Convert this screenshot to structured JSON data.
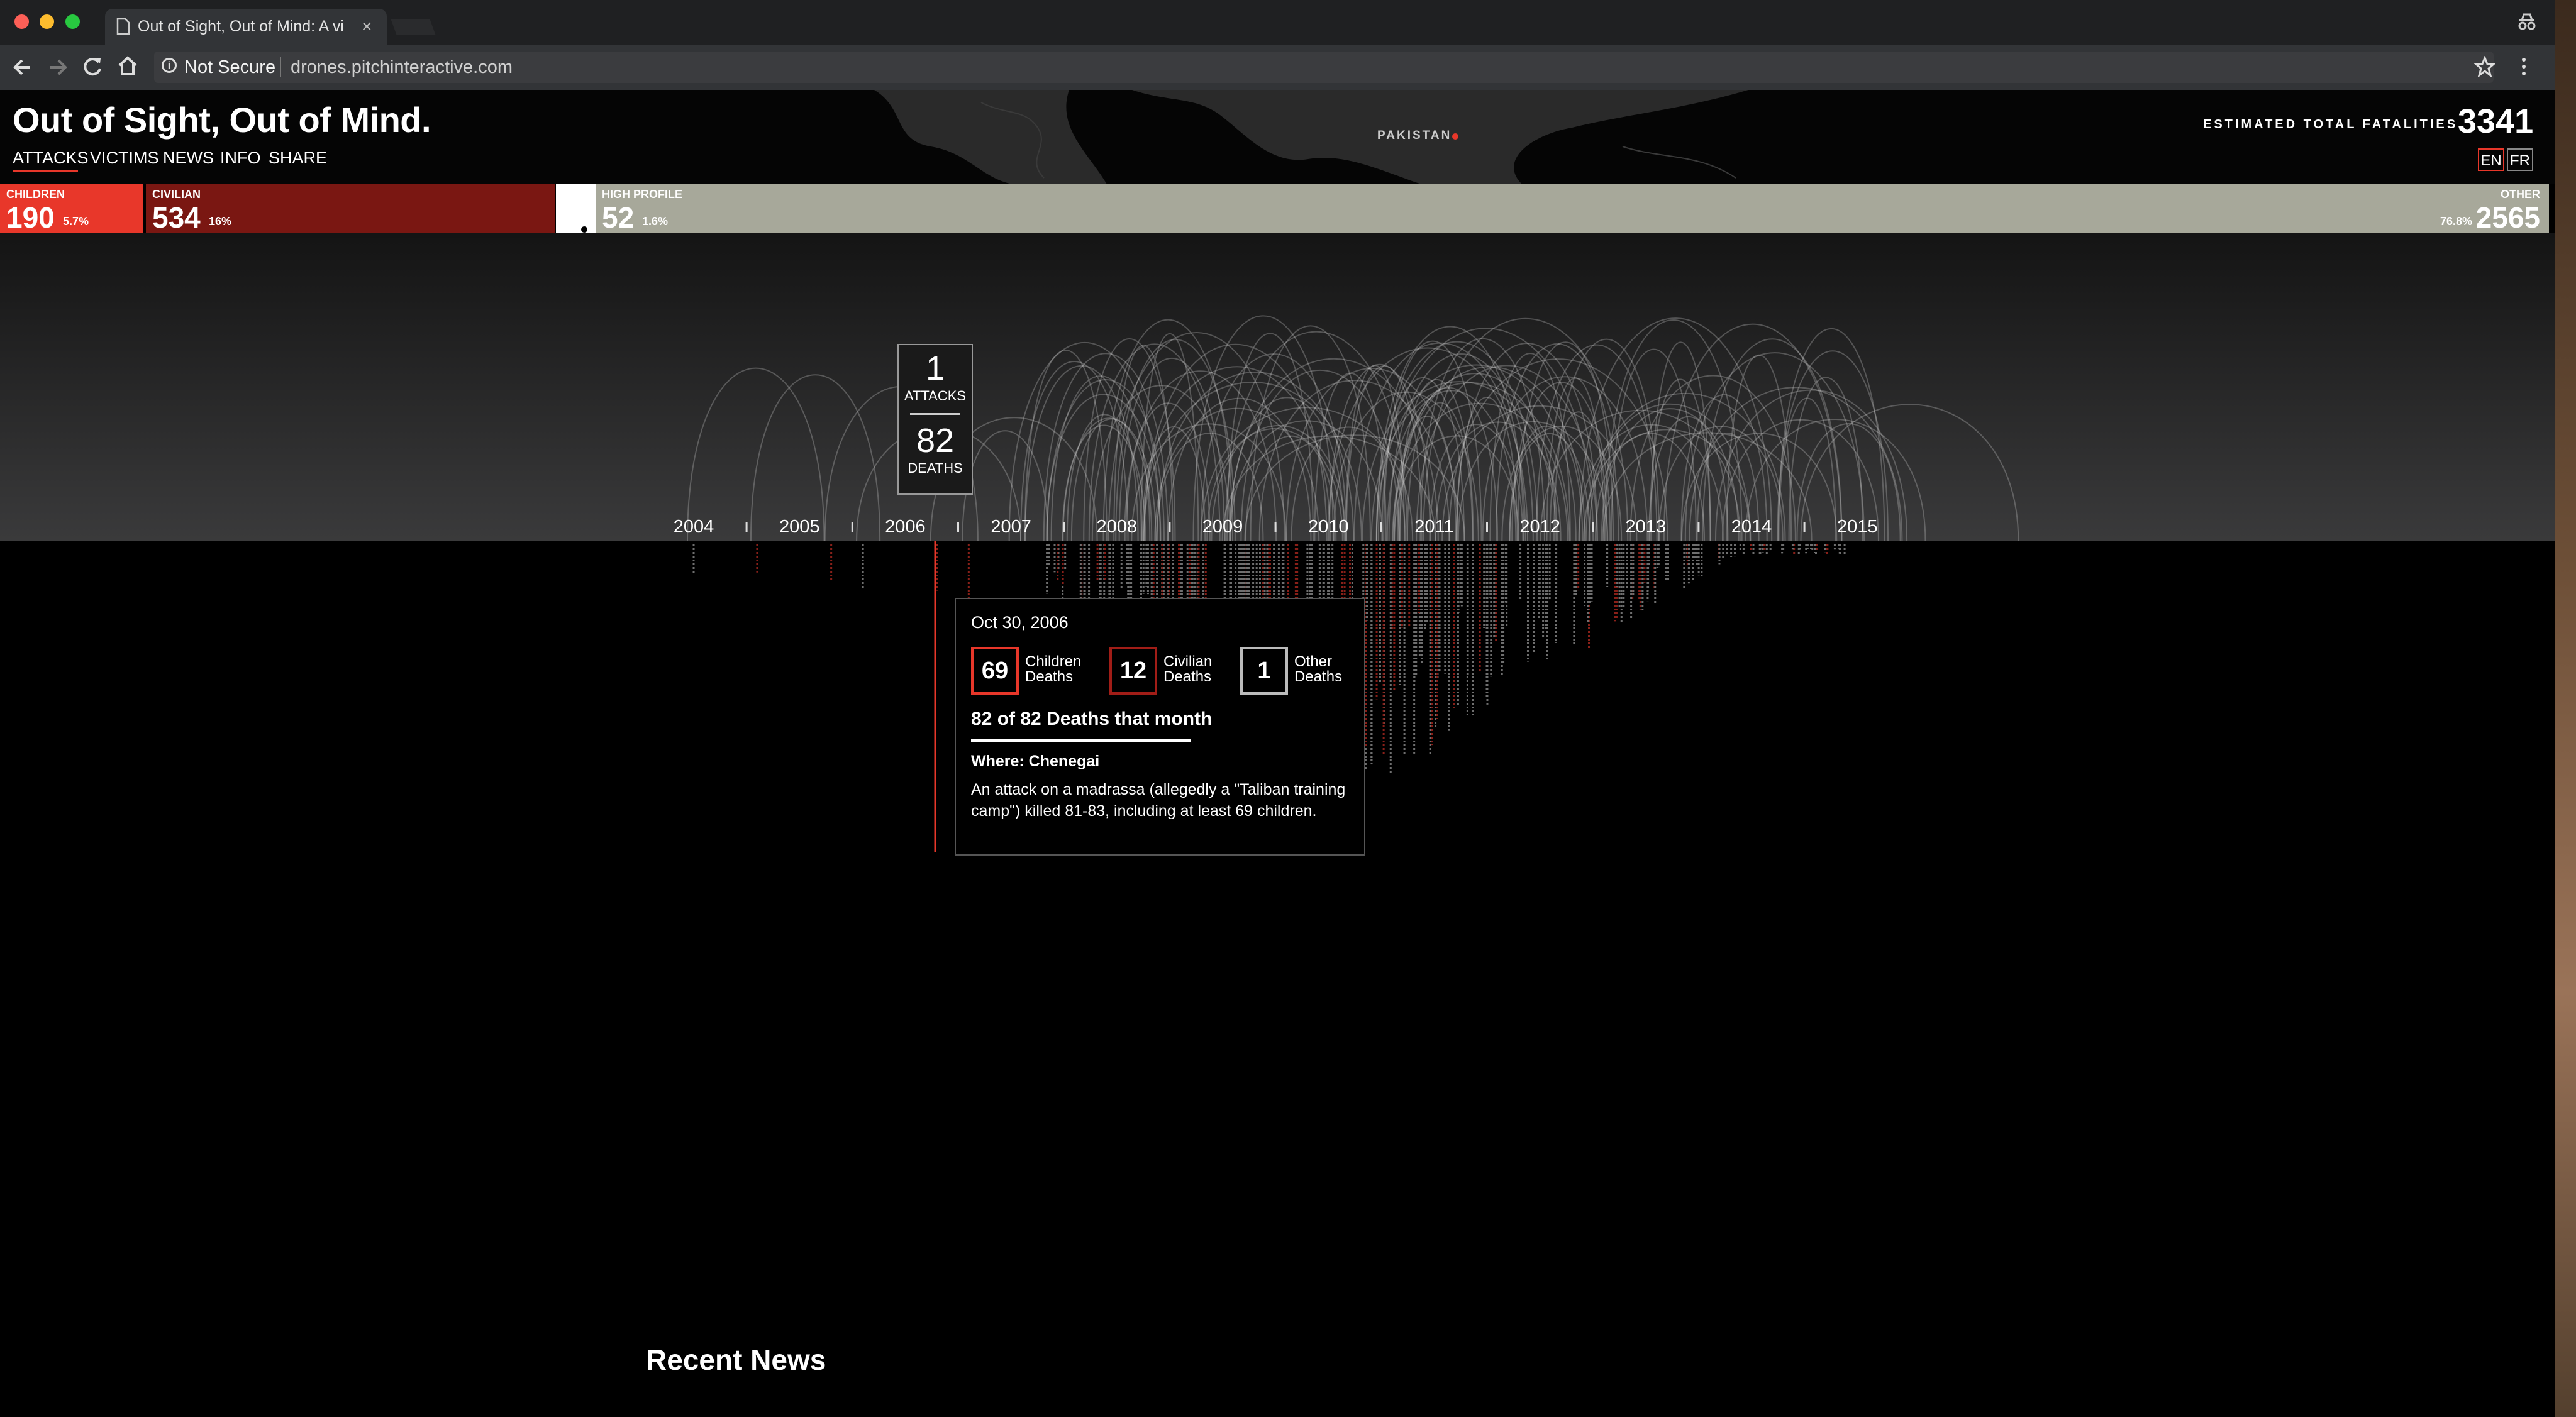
{
  "browser": {
    "tab_title": "Out of Sight, Out of Mind: A vi",
    "tab_close": "×",
    "not_secure": "Not Secure",
    "url": "drones.pitchinteractive.com",
    "info_glyph": "i"
  },
  "header": {
    "title": "Out of Sight, Out of Mind.",
    "nav": [
      "ATTACKS",
      "VICTIMS",
      "NEWS",
      "INFO",
      "SHARE"
    ],
    "active_nav": "ATTACKS",
    "map_label": "PAKISTAN",
    "fatalities_label": "ESTIMATED TOTAL FATALITIES",
    "fatalities_value": "3341",
    "languages": [
      "EN",
      "FR"
    ]
  },
  "categories": {
    "children": {
      "label": "CHILDREN",
      "count": "190",
      "pct": "5.7%",
      "color": "#e8372a"
    },
    "civilian": {
      "label": "CIVILIAN",
      "count": "534",
      "pct": "16%",
      "color": "#7a1712"
    },
    "high_profile": {
      "label": "HIGH PROFILE",
      "count": "52",
      "pct": "1.6%",
      "color": "#ffffff"
    },
    "other": {
      "label": "OTHER",
      "count": "2565",
      "pct": "76.8%",
      "color": "#a7a89a"
    }
  },
  "chart_data": {
    "type": "timeline",
    "years": [
      "2004",
      "2005",
      "2006",
      "2007",
      "2008",
      "2009",
      "2010",
      "2011",
      "2012",
      "2013",
      "2014",
      "2015"
    ],
    "selected_year_position": 2006.83
  },
  "hover_callout": {
    "attacks_value": "1",
    "attacks_label": "ATTACKS",
    "deaths_value": "82",
    "deaths_label": "DEATHS"
  },
  "tooltip": {
    "date": "Oct 30, 2006",
    "children_value": "69",
    "children_label_1": "Children",
    "children_label_2": "Deaths",
    "civilian_value": "12",
    "civilian_label_1": "Civilian",
    "civilian_label_2": "Deaths",
    "other_value": "1",
    "other_label_1": "Other",
    "other_label_2": "Deaths",
    "total_text": "82 of 82 Deaths that month",
    "where": "Where: Chenegai",
    "description": "An attack on a madrassa (allegedly a \"Taliban training camp\") killed 81-83, including at least 69 children."
  },
  "recent_news": "Recent News",
  "colors": {
    "accent": "#e8372a",
    "dark_red": "#7a1712",
    "grey": "#a7a89a"
  }
}
